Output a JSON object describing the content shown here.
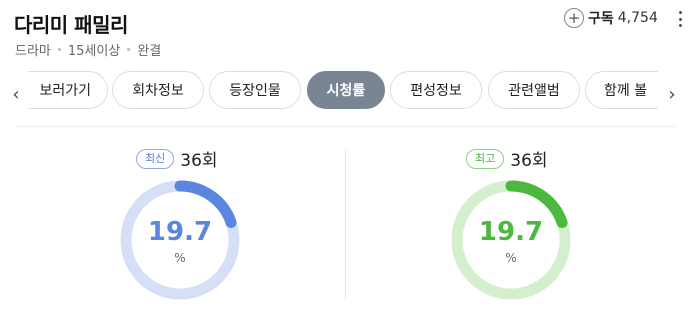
{
  "header": {
    "title": "다리미 패밀리",
    "meta": [
      "드라마",
      "15세이상",
      "완결"
    ]
  },
  "subscribe": {
    "plus": "+",
    "label": "구독",
    "count": "4,754"
  },
  "tabs": [
    {
      "label": "보러가기",
      "active": false
    },
    {
      "label": "회차정보",
      "active": false
    },
    {
      "label": "등장인물",
      "active": false
    },
    {
      "label": "시청률",
      "active": true
    },
    {
      "label": "편성정보",
      "active": false
    },
    {
      "label": "관련앨범",
      "active": false
    },
    {
      "label": "함께 볼",
      "active": false
    }
  ],
  "arrows": {
    "left": "‹",
    "right": "›"
  },
  "ratings": [
    {
      "badge": "최신",
      "episode": "36회",
      "value": "19.7",
      "unit": "%",
      "percent": 19.7,
      "color": "#5b86e0",
      "track": "#d5e0f7"
    },
    {
      "badge": "최고",
      "episode": "36회",
      "value": "19.7",
      "unit": "%",
      "percent": 19.7,
      "color": "#4cb83e",
      "track": "#d3efcd"
    }
  ]
}
